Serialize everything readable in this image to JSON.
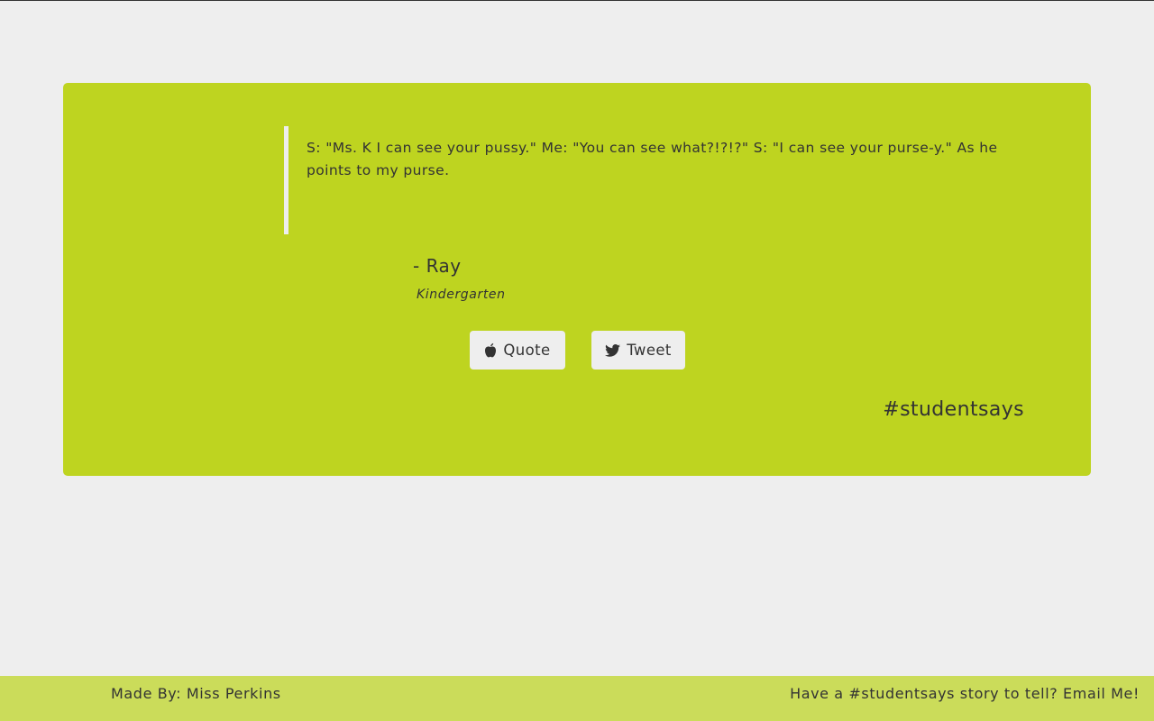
{
  "quote": {
    "text": "S: \"Ms. K I can see your pussy.\" Me: \"You can see what?!?!?\" S: \"I can see your purse-y.\" As he points to my purse.",
    "author": "- Ray",
    "grade": "Kindergarten"
  },
  "buttons": {
    "quote_label": "Quote",
    "quote_icon": "apple-icon",
    "tweet_label": "Tweet",
    "tweet_icon": "twitter-icon"
  },
  "hashtag": "#studentsays",
  "footer": {
    "made_by": "Made By: Miss Perkins",
    "contact": "Have a #studentsays story to tell? Email Me!"
  },
  "colors": {
    "page_background": "#eeeeee",
    "card_background": "#bed420",
    "footer_background": "#cbdc5a",
    "button_background": "#eeeeee",
    "text": "#333333"
  }
}
